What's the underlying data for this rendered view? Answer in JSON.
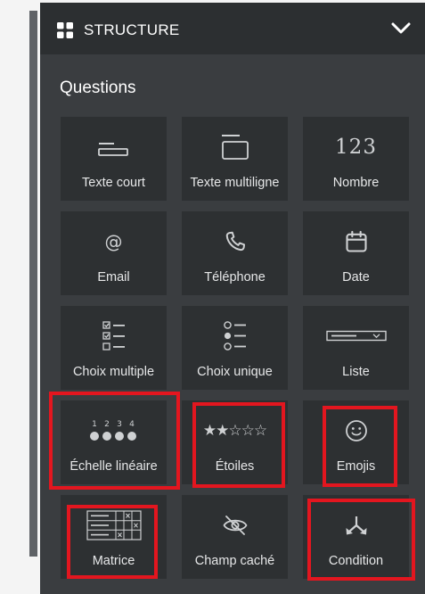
{
  "header": {
    "title": "STRUCTURE",
    "grid_icon": "grid-icon",
    "collapse_icon": "chevron-down-icon"
  },
  "section": {
    "title": "Questions"
  },
  "tiles": [
    {
      "label": "Texte court",
      "icon": "short-text-icon"
    },
    {
      "label": "Texte multiligne",
      "icon": "multiline-text-icon"
    },
    {
      "label": "Nombre",
      "icon": "number-icon"
    },
    {
      "label": "Email",
      "icon": "at-icon"
    },
    {
      "label": "Téléphone",
      "icon": "phone-icon"
    },
    {
      "label": "Date",
      "icon": "calendar-icon"
    },
    {
      "label": "Choix multiple",
      "icon": "checklist-icon"
    },
    {
      "label": "Choix unique",
      "icon": "radio-list-icon"
    },
    {
      "label": "Liste",
      "icon": "dropdown-icon"
    },
    {
      "label": "Échelle linéaire",
      "icon": "linear-scale-icon"
    },
    {
      "label": "Étoiles",
      "icon": "stars-icon"
    },
    {
      "label": "Emojis",
      "icon": "smiley-icon"
    },
    {
      "label": "Matrice",
      "icon": "matrix-icon"
    },
    {
      "label": "Champ caché",
      "icon": "hidden-eye-icon"
    },
    {
      "label": "Condition",
      "icon": "condition-icon"
    }
  ],
  "icon_text": {
    "number": "123",
    "scale_numbers": [
      "1",
      "2",
      "3",
      "4"
    ]
  },
  "colors": {
    "panel": "#3a3d40",
    "header": "#2c2f31",
    "tile": "#2d3032",
    "highlight": "#e3161f",
    "text": "#e6e7e8"
  }
}
